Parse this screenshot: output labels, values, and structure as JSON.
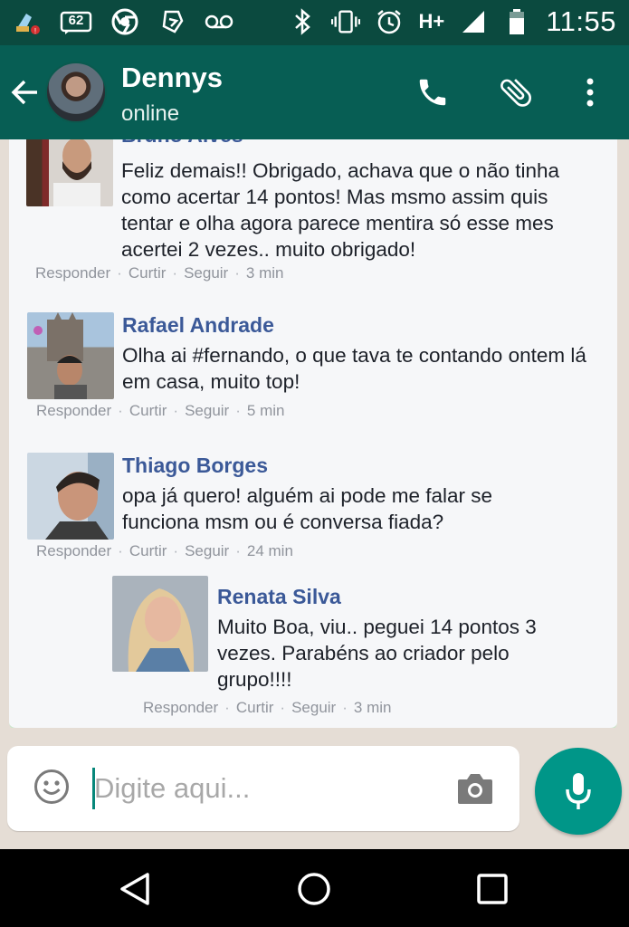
{
  "status_bar": {
    "notification_count": "62",
    "network": "H+",
    "time": "11:55"
  },
  "header": {
    "contact_name": "Dennys",
    "contact_status": "online"
  },
  "comments": [
    {
      "name": "Bruno Alves",
      "text": "Feliz demais!! Obrigado, achava que o não tinha como acertar 14 pontos! Mas msmo assim quis tentar e olha agora parece mentira só esse mes acertei 2 vezes.. muito obrigado!",
      "actions": [
        "Responder",
        "Curtir",
        "Seguir"
      ],
      "time": "3 min"
    },
    {
      "name": "Rafael Andrade",
      "text": "Olha ai #fernando, o que tava te contando ontem lá em casa, muito top!",
      "actions": [
        "Responder",
        "Curtir",
        "Seguir"
      ],
      "time": "5 min"
    },
    {
      "name": "Thiago Borges",
      "text": "opa já quero! alguém ai pode me falar se funciona msm ou é conversa fiada?",
      "actions": [
        "Responder",
        "Curtir",
        "Seguir"
      ],
      "time": "24 min"
    },
    {
      "name": "Renata Silva",
      "text": "Muito Boa, viu.. peguei 14 pontos 3 vezes. Parabéns ao criador pelo grupo!!!!",
      "actions": [
        "Responder",
        "Curtir",
        "Seguir"
      ],
      "time": "3 min"
    }
  ],
  "input": {
    "placeholder": "Digite aqui..."
  },
  "colors": {
    "status_bar": "#0b4a3f",
    "header": "#075e54",
    "accent": "#009688",
    "name_link": "#3b5998"
  },
  "icons": {
    "status_left": [
      "cleaner-icon",
      "notification-count-icon",
      "chrome-icon",
      "moto-icon",
      "voicemail-icon"
    ],
    "status_right": [
      "bluetooth-icon",
      "vibrate-icon",
      "alarm-icon",
      "signal-icon",
      "battery-icon"
    ]
  }
}
